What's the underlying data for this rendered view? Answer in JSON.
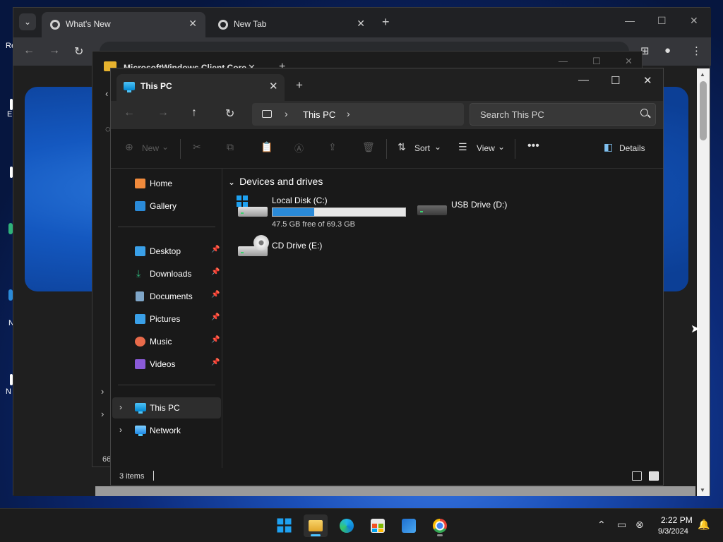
{
  "desktop": {
    "left_fragments": [
      "Re",
      "E",
      "N",
      "N"
    ]
  },
  "chrome": {
    "tabs": [
      {
        "title": "What's New",
        "active": true
      },
      {
        "title": "New Tab",
        "active": false
      }
    ],
    "icons": {
      "tab_search": "chevron-down-icon",
      "new_tab": "plus-icon",
      "minimize": "minimize-icon",
      "maximize": "maximize-icon",
      "close": "close-icon",
      "back": "arrow-left-icon",
      "forward": "arrow-right-icon",
      "reload": "reload-icon",
      "profile": "person-icon",
      "menu": "kebab-menu-icon"
    }
  },
  "explorer_bg": {
    "title": "MicrosoftWindows Client Core",
    "status_fragment": "66"
  },
  "explorer": {
    "tab_title": "This PC",
    "address": {
      "segment": "This PC"
    },
    "search": {
      "placeholder": "Search This PC"
    },
    "commands": {
      "new": "New",
      "sort": "Sort",
      "view": "View",
      "details": "Details"
    },
    "sidebar": {
      "top": [
        {
          "label": "Home",
          "icon": "home-icon",
          "color": "#f08a3c"
        },
        {
          "label": "Gallery",
          "icon": "gallery-icon",
          "color": "#2a8ad8"
        }
      ],
      "pinned": [
        {
          "label": "Desktop",
          "icon": "desktop-icon",
          "color": "#3aa0e8"
        },
        {
          "label": "Downloads",
          "icon": "downloads-icon",
          "color": "#2fb37a"
        },
        {
          "label": "Documents",
          "icon": "documents-icon",
          "color": "#7fa6c8"
        },
        {
          "label": "Pictures",
          "icon": "pictures-icon",
          "color": "#3aa0e8"
        },
        {
          "label": "Music",
          "icon": "music-icon",
          "color": "#e86a4a"
        },
        {
          "label": "Videos",
          "icon": "videos-icon",
          "color": "#8a5ad8"
        }
      ],
      "bottom": [
        {
          "label": "This PC",
          "icon": "this-pc-icon",
          "selected": true
        },
        {
          "label": "Network",
          "icon": "network-icon",
          "selected": false
        }
      ]
    },
    "group_header": "Devices and drives",
    "drives": [
      {
        "name": "Local Disk (C:)",
        "free_text": "47.5 GB free of 69.3 GB",
        "used_fraction": 0.315
      },
      {
        "name": "USB Drive (D:)"
      },
      {
        "name": "CD Drive (E:)"
      }
    ],
    "status": {
      "count": "3 items"
    }
  },
  "taskbar": {
    "apps": [
      {
        "name": "start-icon",
        "active": false,
        "running": false
      },
      {
        "name": "file-explorer-icon",
        "active": true,
        "running": true
      },
      {
        "name": "edge-icon",
        "active": false,
        "running": false
      },
      {
        "name": "microsoft-store-icon",
        "active": false,
        "running": false
      },
      {
        "name": "outlook-icon",
        "active": false,
        "running": false
      },
      {
        "name": "chrome-icon",
        "active": false,
        "running": true
      }
    ],
    "time": "2:22 PM",
    "date": "9/3/2024"
  }
}
